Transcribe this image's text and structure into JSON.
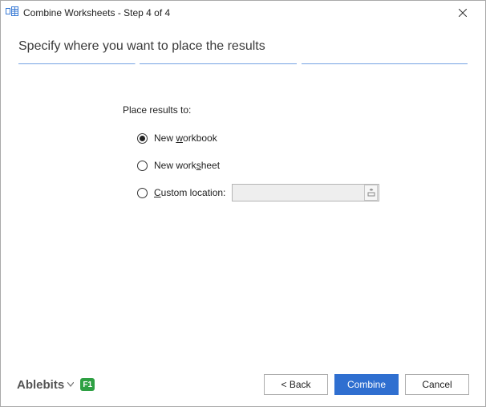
{
  "window": {
    "title": "Combine Worksheets - Step 4 of 4"
  },
  "heading": "Specify where you want to place the results",
  "form": {
    "group_label": "Place results to:",
    "options": {
      "new_workbook": "New workbook",
      "new_worksheet": "New worksheet",
      "custom_location": "Custom location:"
    },
    "custom_location_value": "",
    "selected": "new_workbook"
  },
  "footer": {
    "brand": "Ablebits",
    "help": "F1",
    "buttons": {
      "back": "< Back",
      "combine": "Combine",
      "cancel": "Cancel"
    }
  }
}
